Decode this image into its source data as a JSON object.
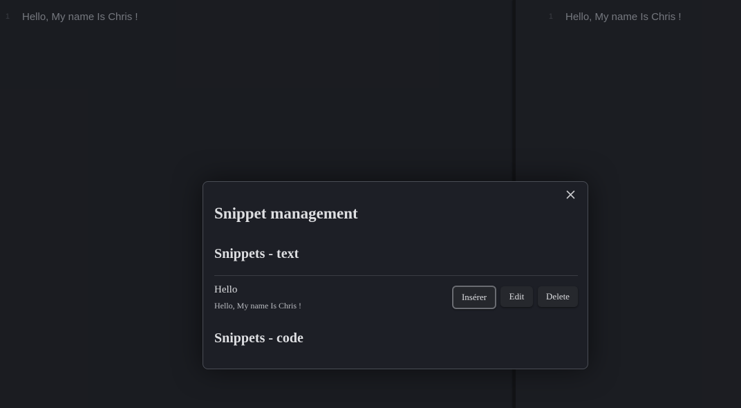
{
  "editor": {
    "left_pane": {
      "line_number": "1",
      "line_text": "Hello, My name Is Chris !"
    },
    "right_pane": {
      "line_number": "1",
      "line_text": "Hello, My name Is Chris !"
    }
  },
  "modal": {
    "title": "Snippet management",
    "close_icon": "close-icon",
    "sections": {
      "text": {
        "title": "Snippets - text",
        "items": [
          {
            "name": "Hello",
            "preview": "Hello, My name Is Chris !",
            "insert_label": "Insérer",
            "edit_label": "Edit",
            "delete_label": "Delete"
          }
        ]
      },
      "code": {
        "title": "Snippets - code"
      }
    }
  },
  "colors": {
    "background": "#1b1d22",
    "modal_background": "#1d1f26",
    "modal_border": "#4a4d55",
    "button_background": "#26282d",
    "focused_button_border": "#6a6c72",
    "text": "#dcdde0",
    "editor_text": "#7c7f86"
  }
}
